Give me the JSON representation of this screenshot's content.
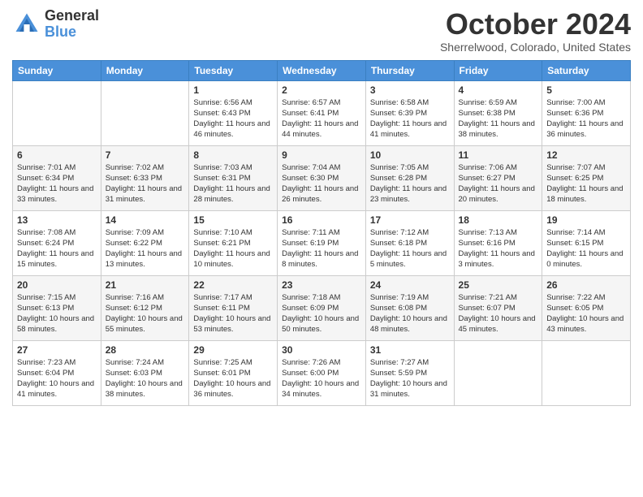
{
  "logo": {
    "general": "General",
    "blue": "Blue"
  },
  "header": {
    "month": "October 2024",
    "location": "Sherrelwood, Colorado, United States"
  },
  "days_of_week": [
    "Sunday",
    "Monday",
    "Tuesday",
    "Wednesday",
    "Thursday",
    "Friday",
    "Saturday"
  ],
  "weeks": [
    [
      {
        "day": "",
        "sunrise": "",
        "sunset": "",
        "daylight": ""
      },
      {
        "day": "",
        "sunrise": "",
        "sunset": "",
        "daylight": ""
      },
      {
        "day": "1",
        "sunrise": "Sunrise: 6:56 AM",
        "sunset": "Sunset: 6:43 PM",
        "daylight": "Daylight: 11 hours and 46 minutes."
      },
      {
        "day": "2",
        "sunrise": "Sunrise: 6:57 AM",
        "sunset": "Sunset: 6:41 PM",
        "daylight": "Daylight: 11 hours and 44 minutes."
      },
      {
        "day": "3",
        "sunrise": "Sunrise: 6:58 AM",
        "sunset": "Sunset: 6:39 PM",
        "daylight": "Daylight: 11 hours and 41 minutes."
      },
      {
        "day": "4",
        "sunrise": "Sunrise: 6:59 AM",
        "sunset": "Sunset: 6:38 PM",
        "daylight": "Daylight: 11 hours and 38 minutes."
      },
      {
        "day": "5",
        "sunrise": "Sunrise: 7:00 AM",
        "sunset": "Sunset: 6:36 PM",
        "daylight": "Daylight: 11 hours and 36 minutes."
      }
    ],
    [
      {
        "day": "6",
        "sunrise": "Sunrise: 7:01 AM",
        "sunset": "Sunset: 6:34 PM",
        "daylight": "Daylight: 11 hours and 33 minutes."
      },
      {
        "day": "7",
        "sunrise": "Sunrise: 7:02 AM",
        "sunset": "Sunset: 6:33 PM",
        "daylight": "Daylight: 11 hours and 31 minutes."
      },
      {
        "day": "8",
        "sunrise": "Sunrise: 7:03 AM",
        "sunset": "Sunset: 6:31 PM",
        "daylight": "Daylight: 11 hours and 28 minutes."
      },
      {
        "day": "9",
        "sunrise": "Sunrise: 7:04 AM",
        "sunset": "Sunset: 6:30 PM",
        "daylight": "Daylight: 11 hours and 26 minutes."
      },
      {
        "day": "10",
        "sunrise": "Sunrise: 7:05 AM",
        "sunset": "Sunset: 6:28 PM",
        "daylight": "Daylight: 11 hours and 23 minutes."
      },
      {
        "day": "11",
        "sunrise": "Sunrise: 7:06 AM",
        "sunset": "Sunset: 6:27 PM",
        "daylight": "Daylight: 11 hours and 20 minutes."
      },
      {
        "day": "12",
        "sunrise": "Sunrise: 7:07 AM",
        "sunset": "Sunset: 6:25 PM",
        "daylight": "Daylight: 11 hours and 18 minutes."
      }
    ],
    [
      {
        "day": "13",
        "sunrise": "Sunrise: 7:08 AM",
        "sunset": "Sunset: 6:24 PM",
        "daylight": "Daylight: 11 hours and 15 minutes."
      },
      {
        "day": "14",
        "sunrise": "Sunrise: 7:09 AM",
        "sunset": "Sunset: 6:22 PM",
        "daylight": "Daylight: 11 hours and 13 minutes."
      },
      {
        "day": "15",
        "sunrise": "Sunrise: 7:10 AM",
        "sunset": "Sunset: 6:21 PM",
        "daylight": "Daylight: 11 hours and 10 minutes."
      },
      {
        "day": "16",
        "sunrise": "Sunrise: 7:11 AM",
        "sunset": "Sunset: 6:19 PM",
        "daylight": "Daylight: 11 hours and 8 minutes."
      },
      {
        "day": "17",
        "sunrise": "Sunrise: 7:12 AM",
        "sunset": "Sunset: 6:18 PM",
        "daylight": "Daylight: 11 hours and 5 minutes."
      },
      {
        "day": "18",
        "sunrise": "Sunrise: 7:13 AM",
        "sunset": "Sunset: 6:16 PM",
        "daylight": "Daylight: 11 hours and 3 minutes."
      },
      {
        "day": "19",
        "sunrise": "Sunrise: 7:14 AM",
        "sunset": "Sunset: 6:15 PM",
        "daylight": "Daylight: 11 hours and 0 minutes."
      }
    ],
    [
      {
        "day": "20",
        "sunrise": "Sunrise: 7:15 AM",
        "sunset": "Sunset: 6:13 PM",
        "daylight": "Daylight: 10 hours and 58 minutes."
      },
      {
        "day": "21",
        "sunrise": "Sunrise: 7:16 AM",
        "sunset": "Sunset: 6:12 PM",
        "daylight": "Daylight: 10 hours and 55 minutes."
      },
      {
        "day": "22",
        "sunrise": "Sunrise: 7:17 AM",
        "sunset": "Sunset: 6:11 PM",
        "daylight": "Daylight: 10 hours and 53 minutes."
      },
      {
        "day": "23",
        "sunrise": "Sunrise: 7:18 AM",
        "sunset": "Sunset: 6:09 PM",
        "daylight": "Daylight: 10 hours and 50 minutes."
      },
      {
        "day": "24",
        "sunrise": "Sunrise: 7:19 AM",
        "sunset": "Sunset: 6:08 PM",
        "daylight": "Daylight: 10 hours and 48 minutes."
      },
      {
        "day": "25",
        "sunrise": "Sunrise: 7:21 AM",
        "sunset": "Sunset: 6:07 PM",
        "daylight": "Daylight: 10 hours and 45 minutes."
      },
      {
        "day": "26",
        "sunrise": "Sunrise: 7:22 AM",
        "sunset": "Sunset: 6:05 PM",
        "daylight": "Daylight: 10 hours and 43 minutes."
      }
    ],
    [
      {
        "day": "27",
        "sunrise": "Sunrise: 7:23 AM",
        "sunset": "Sunset: 6:04 PM",
        "daylight": "Daylight: 10 hours and 41 minutes."
      },
      {
        "day": "28",
        "sunrise": "Sunrise: 7:24 AM",
        "sunset": "Sunset: 6:03 PM",
        "daylight": "Daylight: 10 hours and 38 minutes."
      },
      {
        "day": "29",
        "sunrise": "Sunrise: 7:25 AM",
        "sunset": "Sunset: 6:01 PM",
        "daylight": "Daylight: 10 hours and 36 minutes."
      },
      {
        "day": "30",
        "sunrise": "Sunrise: 7:26 AM",
        "sunset": "Sunset: 6:00 PM",
        "daylight": "Daylight: 10 hours and 34 minutes."
      },
      {
        "day": "31",
        "sunrise": "Sunrise: 7:27 AM",
        "sunset": "Sunset: 5:59 PM",
        "daylight": "Daylight: 10 hours and 31 minutes."
      },
      {
        "day": "",
        "sunrise": "",
        "sunset": "",
        "daylight": ""
      },
      {
        "day": "",
        "sunrise": "",
        "sunset": "",
        "daylight": ""
      }
    ]
  ]
}
